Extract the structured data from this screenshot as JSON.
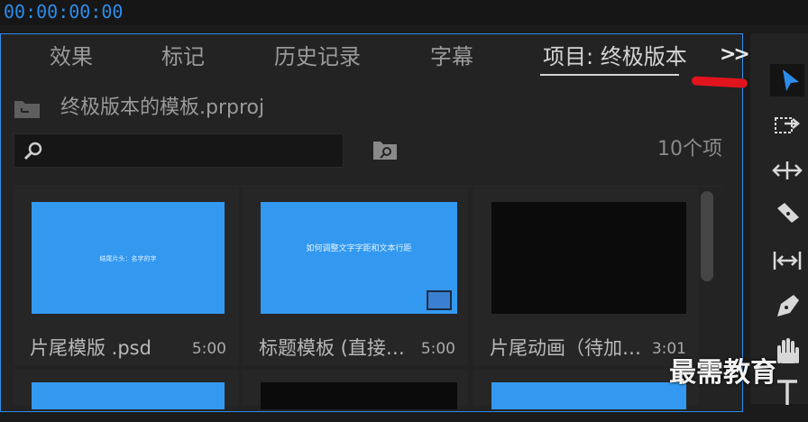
{
  "timecode": "00:00:00:00",
  "tabs": [
    {
      "label": "效果"
    },
    {
      "label": "标记"
    },
    {
      "label": "历史记录"
    },
    {
      "label": "字幕"
    },
    {
      "label": "项目: 终极版本"
    }
  ],
  "project": {
    "name": "终极版本的模板.prproj",
    "item_count": "10个项"
  },
  "search": {
    "placeholder": ""
  },
  "items": [
    {
      "name": "片尾模版 .psd",
      "duration": "5:00",
      "thumbnail": "blue",
      "thumb_text": "结尾片头：名字的字"
    },
    {
      "name": "标题模板 (直接…",
      "duration": "5:00",
      "thumbnail": "blue",
      "thumb_text": "如何调整文字字距和文本行距"
    },
    {
      "name": "片尾动画（待加…",
      "duration": "3:01",
      "thumbnail": "black",
      "thumb_text": ""
    }
  ],
  "watermark": "最需教育",
  "colors": {
    "accent": "#2d8ceb",
    "thumbnail_blue": "#3399f0",
    "annotation_red": "#e0141c"
  },
  "tools": [
    "selection-tool",
    "track-select-tool",
    "ripple-edit-tool",
    "razor-tool",
    "slip-tool",
    "pen-tool",
    "hand-tool",
    "type-tool"
  ]
}
